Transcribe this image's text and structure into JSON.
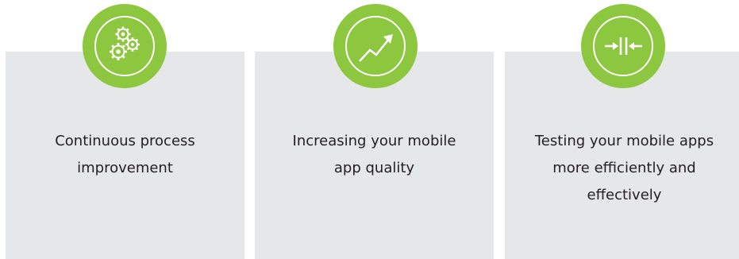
{
  "features": [
    {
      "icon": "gears-icon",
      "caption_lines": [
        "Continuous process",
        "improvement"
      ]
    },
    {
      "icon": "trend-up-arrow-icon",
      "caption_lines": [
        "Increasing your mobile",
        "app quality"
      ]
    },
    {
      "icon": "compress-arrows-icon",
      "caption_lines": [
        "Testing your mobile apps",
        "more efficiently and",
        "effectively"
      ]
    }
  ],
  "colors": {
    "accent_green": "#8dc63f",
    "card_gray": "#e6e7e8",
    "text": "#231f20",
    "icon_white": "#ffffff"
  }
}
